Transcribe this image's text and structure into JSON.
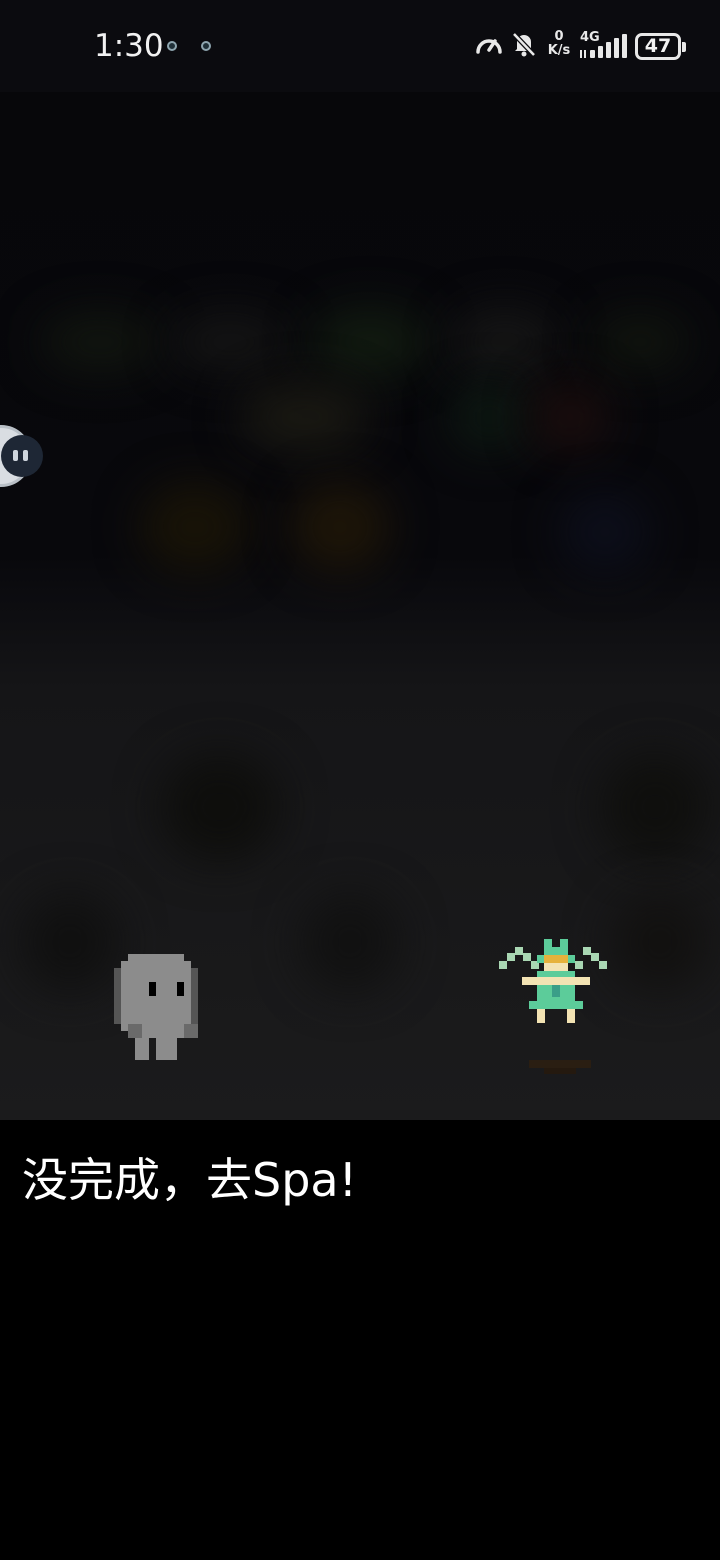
{
  "status_bar": {
    "time": "1:30",
    "net_speed_value": "0",
    "net_speed_unit": "K/s",
    "network_type": "4G",
    "battery_level": "47",
    "icons": [
      "app-notification-dot-icon",
      "app-notification-dot-icon",
      "speed-gauge-icon",
      "bell-muted-icon",
      "signal-bars-icon",
      "battery-icon"
    ]
  },
  "game": {
    "characters": [
      {
        "name": "player-ghost",
        "color": "#8a8a8a"
      },
      {
        "name": "winged-fairy-npc",
        "color": "#5ccc9a"
      }
    ]
  },
  "dialog": {
    "text": "没完成，去Spa!"
  },
  "colors": {
    "background": "#000000",
    "dialog_text": "#ffffff",
    "fairy_green": "#5ccc9a",
    "fairy_skin": "#f3e3b3",
    "fairy_hair": "#e6b23c",
    "ghost_gray": "#8c8c8c"
  }
}
